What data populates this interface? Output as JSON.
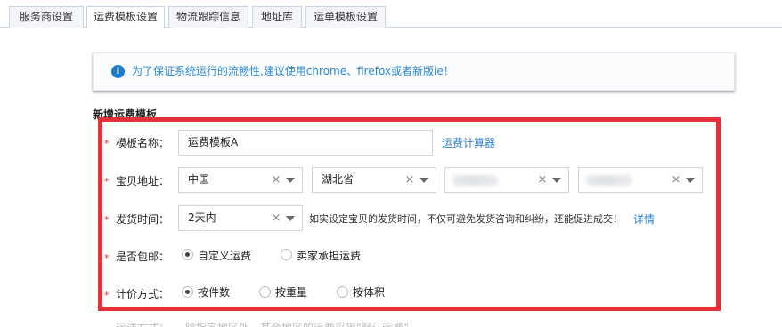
{
  "tabs": [
    {
      "label": "服务商设置",
      "active": false
    },
    {
      "label": "运费模板设置",
      "active": true
    },
    {
      "label": "物流跟踪信息",
      "active": false
    },
    {
      "label": "地址库",
      "active": false
    },
    {
      "label": "运单模板设置",
      "active": false
    }
  ],
  "notice": {
    "icon": "info-icon",
    "text": "为了保证系统运行的流畅性,建议使用chrome、firefox或者新版ie！"
  },
  "section_title": "新增运费模板",
  "form": {
    "template_name": {
      "label": "模板名称：",
      "value": "运费模板A",
      "calc_link": "运费计算器"
    },
    "address": {
      "label": "宝贝地址：",
      "country": "中国",
      "province": "湖北省",
      "city": "",
      "district": ""
    },
    "ship_time": {
      "label": "发货时间：",
      "value": "2天内",
      "hint": "如实设定宝贝的发货时间，不仅可避免发货咨询和纠纷，还能促进成交！",
      "detail_link": "详情"
    },
    "free_shipping": {
      "label": "是否包邮：",
      "options": [
        "自定义运费",
        "卖家承担运费"
      ],
      "selected": "自定义运费"
    },
    "pricing": {
      "label": "计价方式：",
      "options": [
        "按件数",
        "按重量",
        "按体积"
      ],
      "selected": "按件数"
    }
  },
  "footer_partial": {
    "label": "运送方式：",
    "text": "除指定地区外，其余地区的运费采用\"默认运费\""
  },
  "colors": {
    "accent_blue": "#2f7fcf",
    "highlight_red": "#e8303a",
    "tab_border": "#c6d4e3"
  }
}
